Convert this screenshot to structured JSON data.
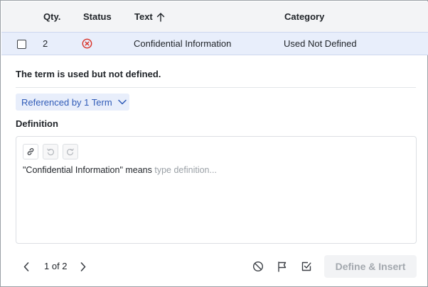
{
  "table": {
    "headers": {
      "qty": "Qty.",
      "status": "Status",
      "text": "Text",
      "category": "Category"
    },
    "row": {
      "qty": "2",
      "status_icon": "error-circle-icon",
      "text": "Confidential Information",
      "category": "Used Not Defined"
    }
  },
  "detail": {
    "message": "The term is used but not defined.",
    "referenced_label": "Referenced by 1 Term",
    "definition_label": "Definition",
    "editor": {
      "prefix": "\"Confidential Information\" means",
      "placeholder": "type definition..."
    }
  },
  "footer": {
    "pager": "1 of 2",
    "define_insert_label": "Define & Insert"
  },
  "colors": {
    "header_bg": "#f3f4f6",
    "selected_row_bg": "#e8eefb",
    "accent": "#2f5bb7",
    "error": "#d93025"
  }
}
